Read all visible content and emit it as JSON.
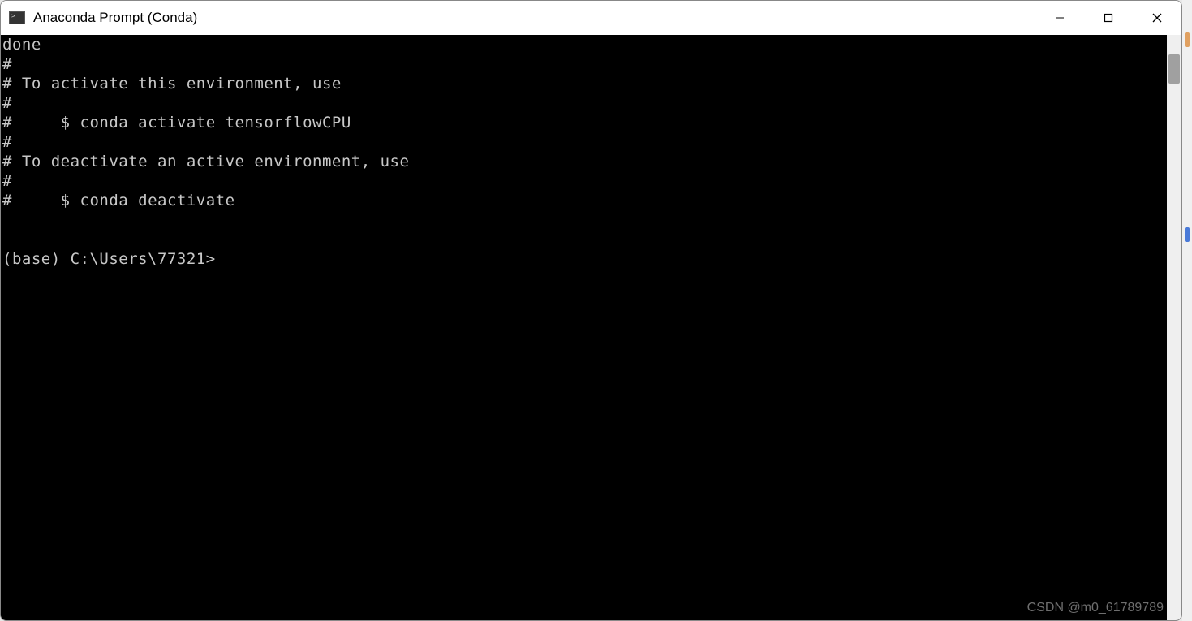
{
  "window": {
    "title": "Anaconda Prompt (Conda)"
  },
  "terminal": {
    "lines": [
      "done",
      "#",
      "# To activate this environment, use",
      "#",
      "#     $ conda activate tensorflowCPU",
      "#",
      "# To deactivate an active environment, use",
      "#",
      "#     $ conda deactivate",
      "",
      "",
      "(base) C:\\Users\\77321>"
    ]
  },
  "watermark": "CSDN @m0_61789789"
}
